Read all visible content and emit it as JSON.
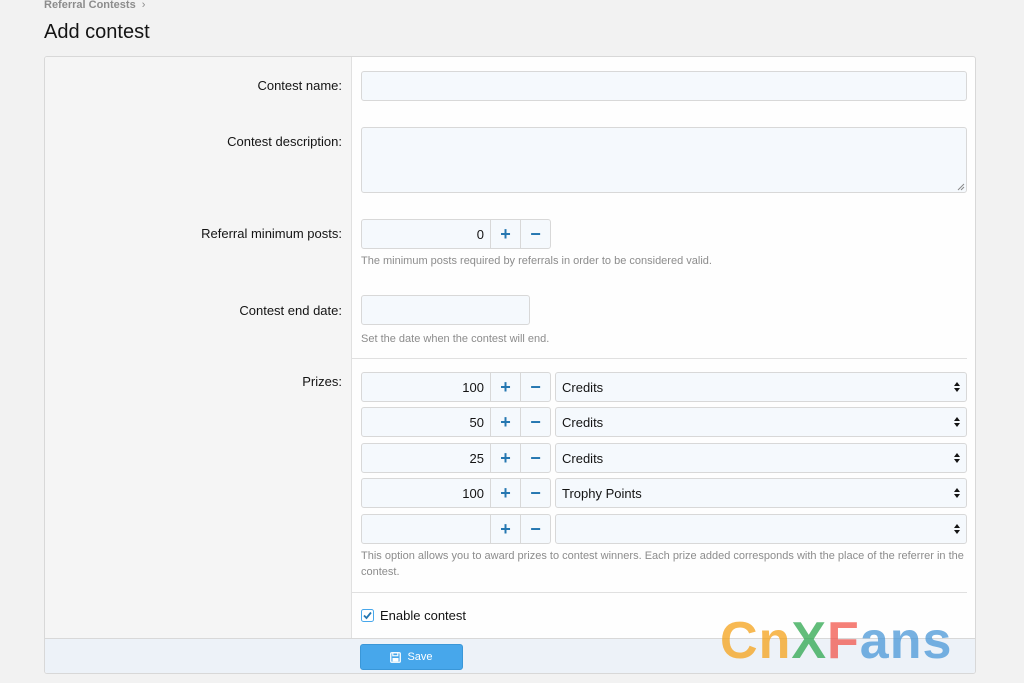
{
  "breadcrumb": {
    "item": "Referral Contests",
    "separator": "›"
  },
  "page": {
    "title": "Add contest"
  },
  "form": {
    "contest_name": {
      "label": "Contest name:",
      "value": ""
    },
    "contest_description": {
      "label": "Contest description:",
      "value": ""
    },
    "min_posts": {
      "label": "Referral minimum posts:",
      "value": "0",
      "hint": "The minimum posts required by referrals in order to be considered valid."
    },
    "end_date": {
      "label": "Contest end date:",
      "value": "",
      "hint": "Set the date when the contest will end."
    },
    "prizes": {
      "label": "Prizes:",
      "rows": [
        {
          "amount": "100",
          "currency": "Credits"
        },
        {
          "amount": "50",
          "currency": "Credits"
        },
        {
          "amount": "25",
          "currency": "Credits"
        },
        {
          "amount": "100",
          "currency": "Trophy Points"
        },
        {
          "amount": "",
          "currency": ""
        }
      ],
      "hint": "This option allows you to award prizes to contest winners. Each prize added corresponds with the place of the referrer in the contest."
    },
    "enable": {
      "label": "Enable contest",
      "checked": true
    },
    "save_label": "Save"
  },
  "icons": {
    "plus": "+",
    "minus": "−",
    "calendar": "calendar-icon",
    "save": "save-icon"
  },
  "colors": {
    "accent": "#47a7eb",
    "link": "#2577b1"
  },
  "watermark": {
    "text": "CnXFans",
    "letters": [
      "C",
      "n",
      "X",
      "F",
      "a",
      "n",
      "s"
    ]
  }
}
